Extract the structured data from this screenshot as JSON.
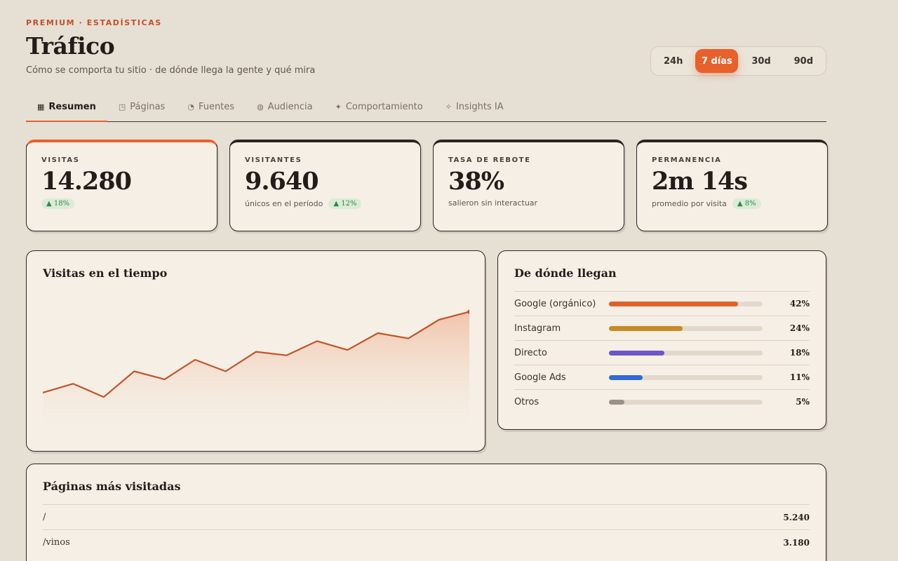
{
  "header": {
    "eyebrow": "PREMIUM · ESTADÍSTICAS",
    "title": "Tráfico",
    "subtitle": "Cómo se comporta tu sitio · de dónde llega la gente y qué mira"
  },
  "range": {
    "options": [
      "24h",
      "7 días",
      "30d",
      "90d"
    ],
    "selected": "7 días"
  },
  "tabs": [
    {
      "icon": "▦",
      "label": "Resumen",
      "active": true
    },
    {
      "icon": "◳",
      "label": "Páginas"
    },
    {
      "icon": "◔",
      "label": "Fuentes"
    },
    {
      "icon": "◍",
      "label": "Audiencia"
    },
    {
      "icon": "✦",
      "label": "Comportamiento"
    },
    {
      "icon": "✧",
      "label": "Insights IA"
    }
  ],
  "kpis": [
    {
      "label": "VISITAS",
      "value": "14.280",
      "note": "",
      "delta": "▲ 18%"
    },
    {
      "label": "VISITANTES",
      "value": "9.640",
      "note": "únicos en el período",
      "delta": "▲ 12%"
    },
    {
      "label": "TASA DE REBOTE",
      "value": "38%",
      "note": "salieron sin interactuar",
      "delta": ""
    },
    {
      "label": "PERMANENCIA",
      "value": "2m 14s",
      "note": "promedio por visita",
      "delta": "▲ 8%"
    }
  ],
  "visits_chart": {
    "title": "Visitas en el tiempo"
  },
  "chart_data": {
    "type": "area",
    "title": "Visitas en el tiempo",
    "xlabel": "",
    "ylabel": "",
    "x": [
      1,
      2,
      3,
      4,
      5,
      6,
      7,
      8,
      9,
      10,
      11,
      12,
      13,
      14,
      15
    ],
    "values": [
      1380,
      1480,
      1330,
      1620,
      1530,
      1750,
      1620,
      1840,
      1800,
      1960,
      1860,
      2050,
      1990,
      2200,
      2290
    ],
    "ylim": [
      1000,
      2500
    ],
    "grid": false,
    "colors": {
      "line": "#c0552c",
      "fill": "#f0c0a4"
    }
  },
  "sources": {
    "title": "De dónde llegan",
    "items": [
      {
        "name": "Google (orgánico)",
        "pct": "42%",
        "fraction": 0.84,
        "color": "#e0602c"
      },
      {
        "name": "Instagram",
        "pct": "24%",
        "fraction": 0.48,
        "color": "#c78a24"
      },
      {
        "name": "Directo",
        "pct": "18%",
        "fraction": 0.36,
        "color": "#6b55c9"
      },
      {
        "name": "Google Ads",
        "pct": "11%",
        "fraction": 0.22,
        "color": "#2f6ad6"
      },
      {
        "name": "Otros",
        "pct": "5%",
        "fraction": 0.1,
        "color": "#9a918a"
      }
    ]
  },
  "pages": {
    "title": "Páginas más visitadas",
    "rows": [
      {
        "path": "/",
        "visits": "5.240"
      },
      {
        "path": "/vinos",
        "visits": "3.180"
      }
    ]
  }
}
